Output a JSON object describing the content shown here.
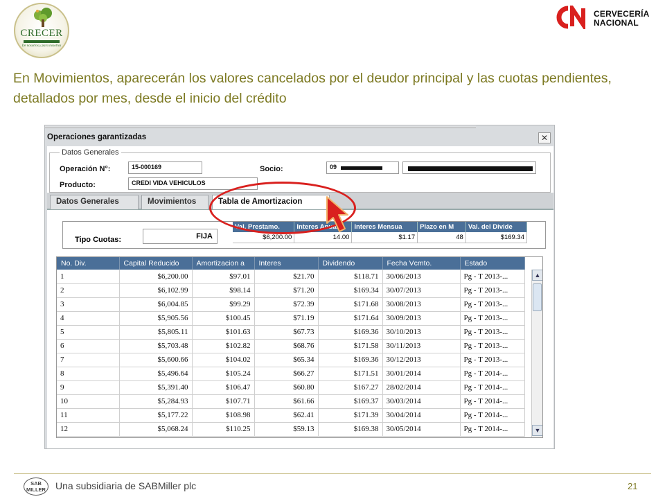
{
  "slide": {
    "intro": "En Movimientos, aparecerán los valores cancelados por el deudor principal y las cuotas pendientes, detallados por mes, desde el inicio del crédito",
    "footer_text": "Una subsidiaria de SABMiller plc",
    "page_number": "21",
    "logo_left": {
      "brand": "CRECER",
      "tagline": "De nosotros y para nosotros"
    },
    "logo_right": {
      "line1": "CERVECERÍA",
      "line2": "NACIONAL"
    },
    "logo_sab": {
      "line1": "SAB",
      "line2": "MILLER"
    },
    "colors": {
      "intro_text": "#7d7a23",
      "callout": "#d9201e",
      "grid_header": "#4a6f98"
    }
  },
  "window": {
    "title": "Operaciones garantizadas",
    "close_glyph": "✕",
    "general": {
      "legend": "Datos Generales",
      "operacion_label": "Operación N°:",
      "operacion_value": "15-000169",
      "socio_label": "Socio:",
      "socio_value_prefix": "09",
      "producto_label": "Producto:",
      "producto_value": "CREDI VIDA VEHICULOS"
    },
    "tabs": [
      "Datos Generales",
      "Movimientos",
      "Tabla de Amortizacion"
    ],
    "active_tab": "Tabla de Amortizacion",
    "summary": {
      "tipo_label": "Tipo Cuotas:",
      "tipo_value": "FIJA",
      "headers": [
        "Val. Prestamo.",
        "Interes Anual",
        "Interes Mensua",
        "Plazo en M",
        "Val. del Divide"
      ],
      "values": [
        "$6,200.00",
        "14.00",
        "$1.17",
        "48",
        "$169.34"
      ]
    },
    "table": {
      "headers": [
        "No. Div.",
        "Capital Reducido",
        "Amortizacion a",
        "Interes",
        "Dividendo",
        "Fecha Vcmto.",
        "Estado"
      ],
      "rows": [
        [
          "1",
          "$6,200.00",
          "$97.01",
          "$21.70",
          "$118.71",
          "30/06/2013",
          "Pg - T 2013-..."
        ],
        [
          "2",
          "$6,102.99",
          "$98.14",
          "$71.20",
          "$169.34",
          "30/07/2013",
          "Pg - T 2013-..."
        ],
        [
          "3",
          "$6,004.85",
          "$99.29",
          "$72.39",
          "$171.68",
          "30/08/2013",
          "Pg - T 2013-..."
        ],
        [
          "4",
          "$5,905.56",
          "$100.45",
          "$71.19",
          "$171.64",
          "30/09/2013",
          "Pg - T 2013-..."
        ],
        [
          "5",
          "$5,805.11",
          "$101.63",
          "$67.73",
          "$169.36",
          "30/10/2013",
          "Pg - T 2013-..."
        ],
        [
          "6",
          "$5,703.48",
          "$102.82",
          "$68.76",
          "$171.58",
          "30/11/2013",
          "Pg - T 2013-..."
        ],
        [
          "7",
          "$5,600.66",
          "$104.02",
          "$65.34",
          "$169.36",
          "30/12/2013",
          "Pg - T 2013-..."
        ],
        [
          "8",
          "$5,496.64",
          "$105.24",
          "$66.27",
          "$171.51",
          "30/01/2014",
          "Pg - T 2014-..."
        ],
        [
          "9",
          "$5,391.40",
          "$106.47",
          "$60.80",
          "$167.27",
          "28/02/2014",
          "Pg - T 2014-..."
        ],
        [
          "10",
          "$5,284.93",
          "$107.71",
          "$61.66",
          "$169.37",
          "30/03/2014",
          "Pg - T 2014-..."
        ],
        [
          "11",
          "$5,177.22",
          "$108.98",
          "$62.41",
          "$171.39",
          "30/04/2014",
          "Pg - T 2014-..."
        ],
        [
          "12",
          "$5,068.24",
          "$110.25",
          "$59.13",
          "$169.38",
          "30/05/2014",
          "Pg - T 2014-..."
        ]
      ]
    },
    "scroll": {
      "up": "▲",
      "down": "▼"
    }
  }
}
